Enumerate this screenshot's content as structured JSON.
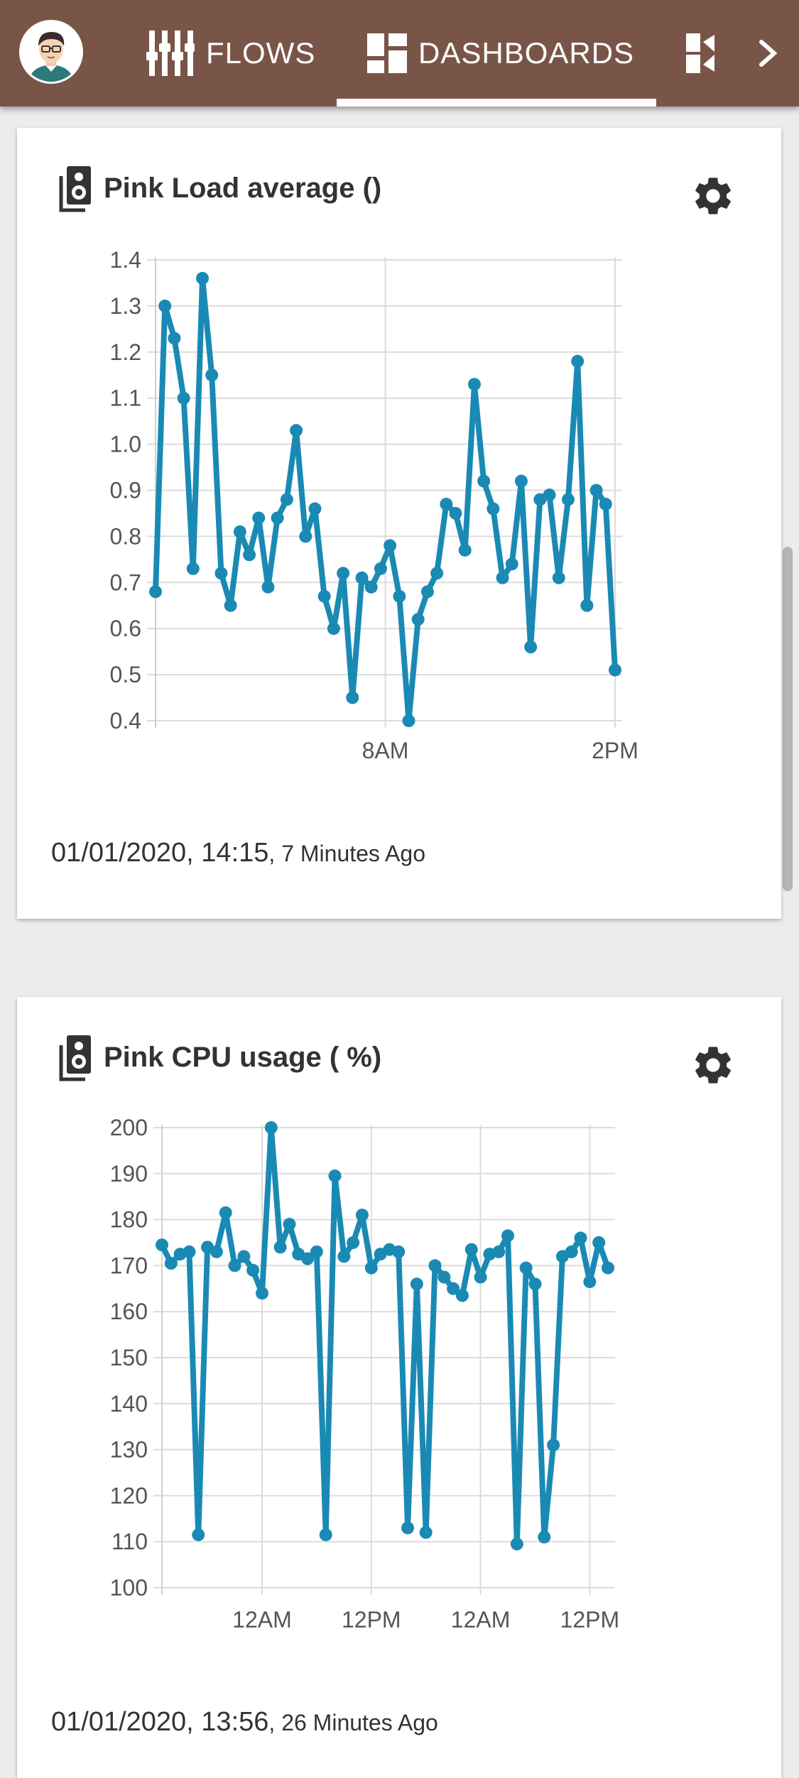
{
  "nav": {
    "tabs": [
      {
        "label": "FLOWS",
        "icon": "flows-icon"
      },
      {
        "label": "DASHBOARDS",
        "icon": "dashboards-icon",
        "active": true
      },
      {
        "label": "",
        "icon": "panels-icon"
      }
    ],
    "colors": {
      "appbar": "#795548",
      "series": "#1a8ab4"
    }
  },
  "cards": [
    {
      "title": "Pink Load average ()",
      "timestamp": "01/01/2020, 14:15",
      "ago": ", 7 Minutes Ago"
    },
    {
      "title": "Pink CPU usage ( %)",
      "timestamp": "01/01/2020, 13:56",
      "ago": ", 26 Minutes Ago"
    }
  ],
  "chart_data": [
    {
      "type": "line",
      "title": "Pink Load average ()",
      "ylim": [
        0.4,
        1.4
      ],
      "yticks": [
        "1.4",
        "1.3",
        "1.2",
        "1.1",
        "1.0",
        "0.9",
        "0.8",
        "0.7",
        "0.6",
        "0.5",
        "0.4"
      ],
      "xlim": [
        0,
        49
      ],
      "xtick_labels": [
        {
          "x": 24.5,
          "label": "8AM"
        },
        {
          "x": 49,
          "label": "2PM"
        }
      ],
      "grid": true,
      "series": [
        {
          "values": [
            0.68,
            1.3,
            1.23,
            1.1,
            0.73,
            1.36,
            1.15,
            0.72,
            0.65,
            0.81,
            0.76,
            0.84,
            0.69,
            0.84,
            0.88,
            1.03,
            0.8,
            0.86,
            0.67,
            0.6,
            0.72,
            0.45,
            0.71,
            0.69,
            0.73,
            0.78,
            0.67,
            0.4,
            0.62,
            0.68,
            0.72,
            0.87,
            0.85,
            0.77,
            1.13,
            0.92,
            0.86,
            0.71,
            0.74,
            0.92,
            0.56,
            0.88,
            0.89,
            0.71,
            0.88,
            1.18,
            0.65,
            0.9,
            0.87,
            0.51
          ]
        }
      ]
    },
    {
      "type": "line",
      "title": "Pink CPU usage ( %)",
      "ylim": [
        100,
        200
      ],
      "yticks": [
        "200",
        "190",
        "180",
        "170",
        "160",
        "150",
        "140",
        "130",
        "120",
        "110",
        "100"
      ],
      "xlim": [
        0,
        49
      ],
      "xtick_labels": [
        {
          "x": 11,
          "label": "12AM"
        },
        {
          "x": 23,
          "label": "12PM"
        },
        {
          "x": 35,
          "label": "12AM"
        },
        {
          "x": 47,
          "label": "12PM"
        }
      ],
      "grid": true,
      "series": [
        {
          "values": [
            174.5,
            170.5,
            172.5,
            173,
            111.5,
            174,
            173,
            181.5,
            170,
            172,
            169,
            164,
            200,
            174,
            179,
            172.5,
            171.5,
            173,
            111.5,
            189.5,
            172,
            175,
            181,
            169.5,
            172.5,
            173.5,
            173,
            113,
            166,
            112,
            170,
            167.5,
            165,
            163.5,
            173.5,
            167.5,
            172.5,
            173,
            176.5,
            109.5,
            169.5,
            166,
            111,
            131,
            172,
            173,
            176,
            166.5,
            175,
            169.5
          ]
        }
      ]
    }
  ]
}
